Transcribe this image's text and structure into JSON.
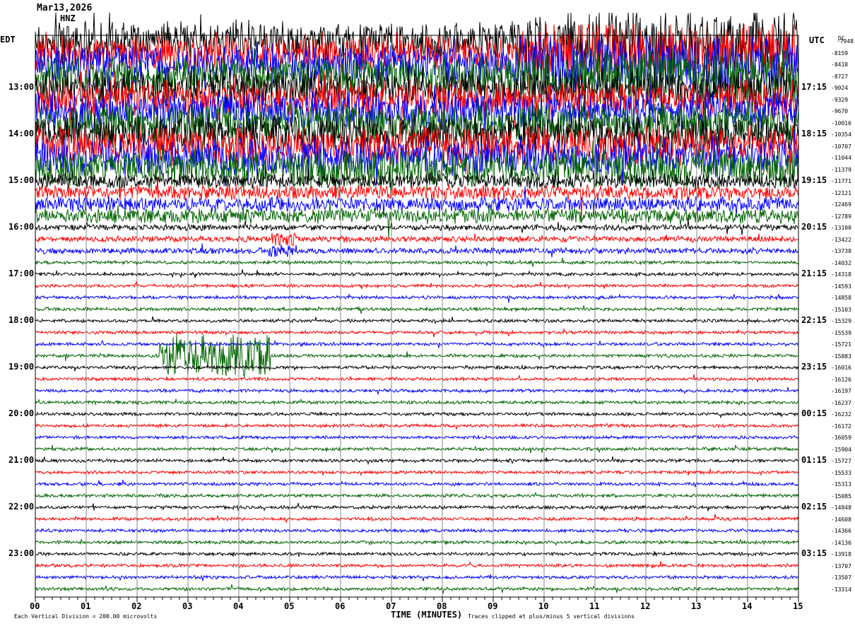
{
  "header": {
    "date": "Mar13,2026",
    "channel": "HNZ"
  },
  "left_zone": "EDT",
  "right_zone": "UTC",
  "right_header": "DC",
  "chart_data": {
    "type": "line",
    "xlabel": "TIME (MINUTES)",
    "x_ticks": [
      "00",
      "01",
      "02",
      "03",
      "04",
      "05",
      "06",
      "07",
      "08",
      "09",
      "10",
      "11",
      "12",
      "13",
      "14",
      "15"
    ],
    "xlim": [
      0,
      15
    ],
    "grid": true,
    "left_labels": [
      {
        "row": 4,
        "text": "13:00"
      },
      {
        "row": 8,
        "text": "14:00"
      },
      {
        "row": 12,
        "text": "15:00"
      },
      {
        "row": 16,
        "text": "16:00"
      },
      {
        "row": 20,
        "text": "17:00"
      },
      {
        "row": 24,
        "text": "18:00"
      },
      {
        "row": 28,
        "text": "19:00"
      },
      {
        "row": 32,
        "text": "20:00"
      },
      {
        "row": 36,
        "text": "21:00"
      },
      {
        "row": 40,
        "text": "22:00"
      },
      {
        "row": 44,
        "text": "23:00"
      }
    ],
    "right_labels": [
      {
        "row": 4,
        "text": "17:15"
      },
      {
        "row": 8,
        "text": "18:15"
      },
      {
        "row": 12,
        "text": "19:15"
      },
      {
        "row": 16,
        "text": "20:15"
      },
      {
        "row": 20,
        "text": "21:15"
      },
      {
        "row": 24,
        "text": "22:15"
      },
      {
        "row": 28,
        "text": "23:15"
      },
      {
        "row": 32,
        "text": "00:15"
      },
      {
        "row": 36,
        "text": "01:15"
      },
      {
        "row": 40,
        "text": "02:15"
      },
      {
        "row": 44,
        "text": "03:15"
      }
    ],
    "trace_colors": [
      "#000000",
      "#ff0000",
      "#0000ff",
      "#006400"
    ],
    "dc_offsets": [
      -7948,
      -8159,
      -8418,
      -8727,
      -9024,
      -9329,
      -9670,
      -10016,
      -10354,
      -10707,
      -11044,
      -11379,
      -11771,
      -12121,
      -12469,
      -12789,
      -13100,
      -13422,
      -13738,
      -14032,
      -14318,
      -14593,
      -14858,
      -15103,
      -15329,
      -15539,
      -15721,
      -15883,
      -16016,
      -16126,
      -16197,
      -16237,
      -16232,
      -16172,
      -16059,
      -15904,
      -15727,
      -15533,
      -15313,
      -15085,
      -14848,
      -14608,
      -14366,
      -14136,
      -13918,
      -13707,
      -13507,
      -13314
    ],
    "scale_note": "Each Vertical Division =  200.00 microvolts",
    "clip_note": "Traces clipped at plus/minus 5 vertical divisions"
  }
}
